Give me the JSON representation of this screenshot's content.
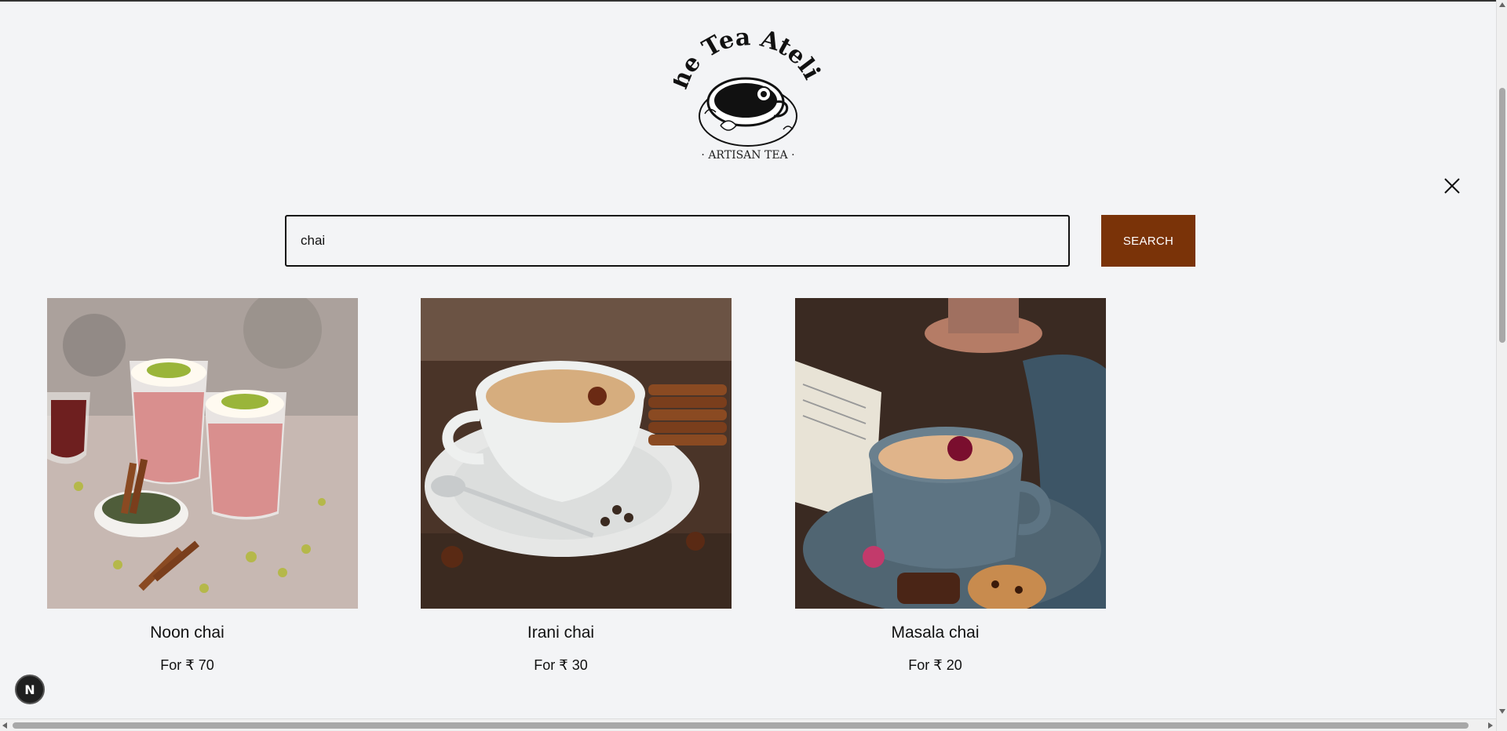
{
  "brand": {
    "name": "The Tea Atelier",
    "tagline": "· ARTISAN TEA ·",
    "icon": "teacup-logo"
  },
  "search": {
    "value": "chai",
    "button_label": "SEARCH"
  },
  "close": {
    "icon": "close-icon"
  },
  "products": [
    {
      "name": "Noon chai",
      "price": "For ₹ 70"
    },
    {
      "name": "Irani chai",
      "price": "For ₹ 30"
    },
    {
      "name": "Masala chai",
      "price": "For ₹ 20"
    }
  ],
  "dev_badge": {
    "label": "N"
  },
  "colors": {
    "background": "#f3f4f6",
    "accent": "#7a3308",
    "text": "#111111"
  }
}
